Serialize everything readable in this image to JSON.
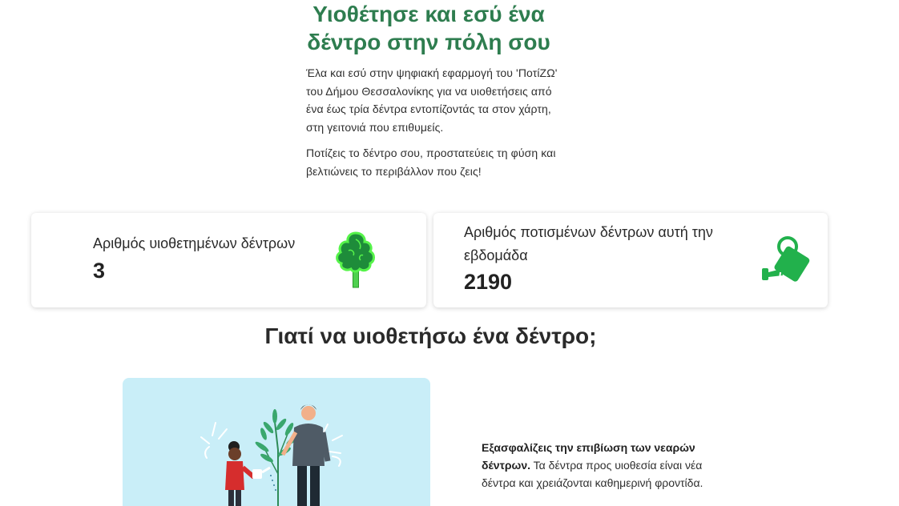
{
  "hero": {
    "title_line1": "Υιοθέτησε και εσύ ένα",
    "title_line2": "δέντρο στην πόλη σου",
    "paragraph1": "Έλα και εσύ στην ψηφιακή εφαρμογή του 'ΠοτίΖΩ' του Δήμου Θεσσαλονίκης για να υιοθετήσεις από ένα έως τρία δέντρα εντοπίζοντάς τα στον χάρτη, στη γειτονιά που επιθυμείς.",
    "paragraph2": "Ποτίζεις το δέντρο σου, προστατεύεις τη φύση και βελτιώνεις το περιβάλλον που ζεις!"
  },
  "stats": {
    "adopted": {
      "label": "Αριθμός υιοθετημένων δέντρων",
      "value": "3",
      "icon": "tree-icon"
    },
    "watered": {
      "label": "Αριθμός ποτισμένων δέντρων αυτή την εβδομάδα",
      "value": "2190",
      "icon": "watering-can-icon"
    }
  },
  "why": {
    "heading": "Γιατί να υιοθετήσω ένα δέντρο;",
    "benefit_title": "Εξασφαλίζεις την επιβίωση των νεαρών δέντρων.",
    "benefit_text": "Τα δέντρα προς υιοθεσία είναι νέα δέντρα και χρειάζονται καθημερινή φροντίδα."
  },
  "colors": {
    "title_green": "#2e7d4f",
    "icon_green": "#22b14c",
    "illustration_bg": "#c9eef8"
  }
}
